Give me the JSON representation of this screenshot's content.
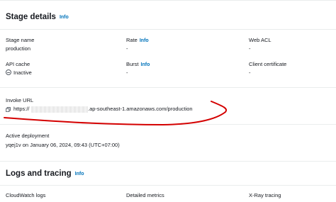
{
  "stage_details": {
    "title": "Stage details",
    "info": "Info",
    "stage_name_label": "Stage name",
    "stage_name": "production",
    "rate_label": "Rate",
    "rate_info": "Info",
    "rate_value": "-",
    "web_acl_label": "Web ACL",
    "web_acl_value": "-",
    "api_cache_label": "API cache",
    "api_cache_value": "Inactive",
    "burst_label": "Burst",
    "burst_info": "Info",
    "burst_value": "-",
    "client_cert_label": "Client certificate",
    "client_cert_value": "-",
    "invoke_url_label": "Invoke URL",
    "invoke_url_prefix": "https://",
    "invoke_url_suffix": ".ap-southeast-1.amazonaws.com/production",
    "active_deployment_label": "Active deployment",
    "active_deployment_value": "yqej1v on January 06, 2024, 09:43 (UTC+07:00)"
  },
  "logs_tracing": {
    "title": "Logs and tracing",
    "info": "Info",
    "cloudwatch_label": "CloudWatch logs",
    "detailed_metrics_label": "Detailed metrics",
    "xray_label": "X-Ray tracing"
  },
  "icons": {
    "copy": "copy-icon",
    "inactive": "inactive-status-icon"
  },
  "colors": {
    "link": "#0073bb",
    "annotation": "#d40000"
  }
}
